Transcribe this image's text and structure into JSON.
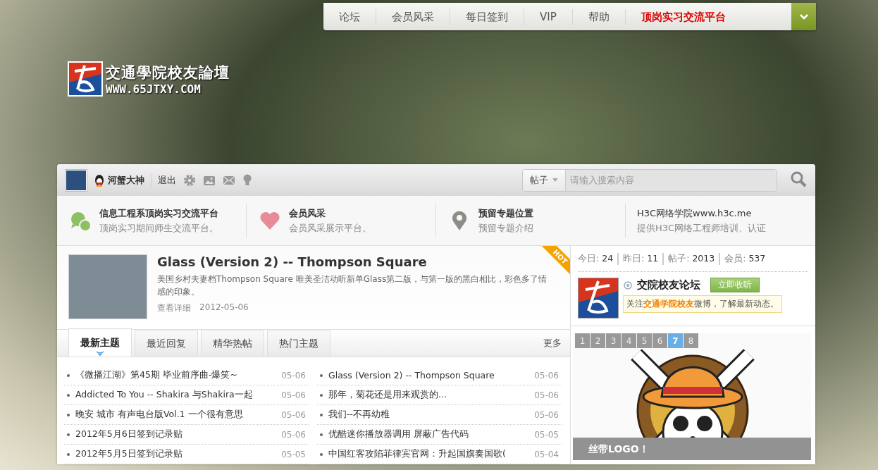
{
  "nav": {
    "items": [
      {
        "label": "论坛",
        "kind": "link"
      },
      {
        "label": "会员风采",
        "kind": "link"
      },
      {
        "label": "每日签到",
        "kind": "link"
      },
      {
        "label": "VIP",
        "kind": "link"
      },
      {
        "label": "帮助",
        "kind": "link"
      },
      {
        "label": "顶岗实习交流平台",
        "kind": "promo"
      }
    ]
  },
  "logo": {
    "title": "交通學院校友論壇",
    "url": "WWW.65JTXY.COM"
  },
  "user": {
    "name": "河蟹大神",
    "logout": "退出"
  },
  "search": {
    "scope": "帖子",
    "placeholder": "请输入搜索内容"
  },
  "features": [
    {
      "kind": "chat",
      "title": "信息工程系顶岗实习交流平台",
      "desc": "顶岗实习期间师生交流平台。"
    },
    {
      "kind": "heart",
      "title": "会员风采",
      "desc": "会员风采展示平台。"
    },
    {
      "kind": "pin",
      "title": "预留专题位置",
      "desc": "预留专题介绍"
    },
    {
      "kind": "none",
      "title": "H3C网络学院www.h3c.me",
      "desc": "提供H3C网络工程师培训、认证"
    }
  ],
  "featured": {
    "title": "Glass (Version 2) -- Thompson Square",
    "desc": "美国乡村夫妻档Thompson Square 唯美圣洁动听新单Glass第二版，与第一版的黑白相比，彩色多了情感的印象。",
    "more": "查看详细",
    "date": "2012-05-06",
    "badge": "HOT"
  },
  "tabs": [
    {
      "label": "最新主题",
      "selected": true
    },
    {
      "label": "最近回复",
      "selected": false
    },
    {
      "label": "精华热帖",
      "selected": false
    },
    {
      "label": "热门主题",
      "selected": false
    }
  ],
  "tabs_more": "更多",
  "threads": [
    {
      "title": "《微播江湖》第45期 毕业前序曲-爆笑~",
      "date": "05-06"
    },
    {
      "title": "Glass (Version 2) -- Thompson Square",
      "date": "05-06"
    },
    {
      "title": "Addicted To You -- Shakira 与Shakira一起",
      "date": "05-06"
    },
    {
      "title": "那年，菊花还是用来观赏的...",
      "date": "05-06"
    },
    {
      "title": "晚安 城市 有声电台版Vol.1 一个很有意思",
      "date": "05-06"
    },
    {
      "title": "我们--不再幼稚",
      "date": "05-06"
    },
    {
      "title": "2012年5月6日签到记录贴",
      "date": "05-06"
    },
    {
      "title": "优酷迷你播放器调用 屏蔽广告代码",
      "date": "05-05"
    },
    {
      "title": "2012年5月5日签到记录贴",
      "date": "05-05"
    },
    {
      "title": "中国红客攻陷菲律宾官网：升起国旗奏国歌(",
      "date": "05-04"
    }
  ],
  "stats": [
    {
      "label": "今日:",
      "value": "24"
    },
    {
      "label": "昨日:",
      "value": "11"
    },
    {
      "label": "帖子:",
      "value": "2013"
    },
    {
      "label": "会员:",
      "value": "537"
    }
  ],
  "weibo": {
    "name": "交院校友论坛",
    "follow": "立即收听",
    "note": "关注**交通学院校友**微博，了解最新动态。"
  },
  "slideshow": {
    "pages": [
      {
        "label": "1",
        "selected": false
      },
      {
        "label": "2",
        "selected": false
      },
      {
        "label": "3",
        "selected": false
      },
      {
        "label": "4",
        "selected": false
      },
      {
        "label": "5",
        "selected": false
      },
      {
        "label": "6",
        "selected": false
      },
      {
        "label": "7",
        "selected": true
      },
      {
        "label": "8",
        "selected": false
      }
    ],
    "caption": "丝带LOGO！"
  }
}
